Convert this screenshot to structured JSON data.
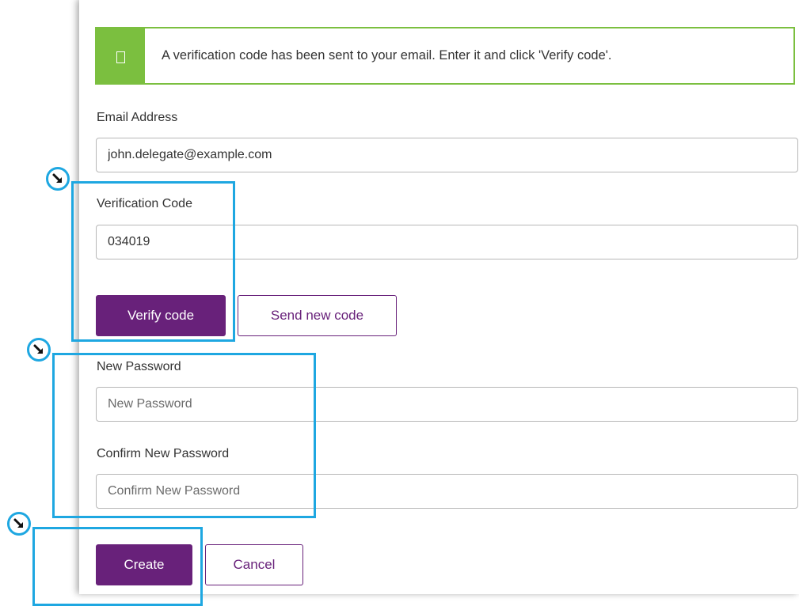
{
  "alert": {
    "message": "A verification code has been sent to your email. Enter it and click 'Verify code'.",
    "icon": "info-square-icon"
  },
  "form": {
    "email": {
      "label": "Email Address",
      "value": "john.delegate@example.com"
    },
    "verification": {
      "label": "Verification Code",
      "value": "034019"
    },
    "verify_button": "Verify code",
    "send_new_code_button": "Send new code",
    "new_password": {
      "label": "New Password",
      "placeholder": "New Password"
    },
    "confirm_password": {
      "label": "Confirm New Password",
      "placeholder": "Confirm New Password"
    },
    "create_button": "Create",
    "cancel_button": "Cancel"
  },
  "colors": {
    "alert_accent": "#7bbf3f",
    "primary": "#68217a",
    "callout": "#1ea7e1"
  },
  "callouts": {
    "icon": "arrow-down-right-icon",
    "count": 3
  }
}
